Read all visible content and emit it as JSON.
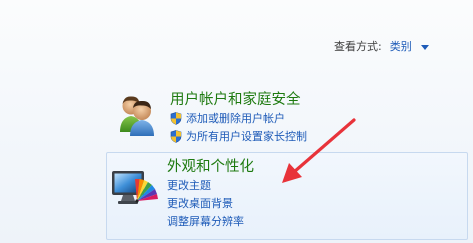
{
  "header": {
    "view_by_label": "查看方式:",
    "view_by_value": "类别"
  },
  "categories": [
    {
      "title": "用户帐户和家庭安全",
      "icon": "users-icon",
      "links": [
        {
          "label": "添加或删除用户帐户",
          "icon": "uac-shield-icon"
        },
        {
          "label": "为所有用户设置家长控制",
          "icon": "uac-shield-icon"
        }
      ]
    },
    {
      "title": "外观和个性化",
      "icon": "monitor-palette-icon",
      "links": [
        {
          "label": "更改主题"
        },
        {
          "label": "更改桌面背景"
        },
        {
          "label": "调整屏幕分辨率"
        }
      ]
    }
  ],
  "annotation": {
    "arrow_color": "#e8333a"
  }
}
